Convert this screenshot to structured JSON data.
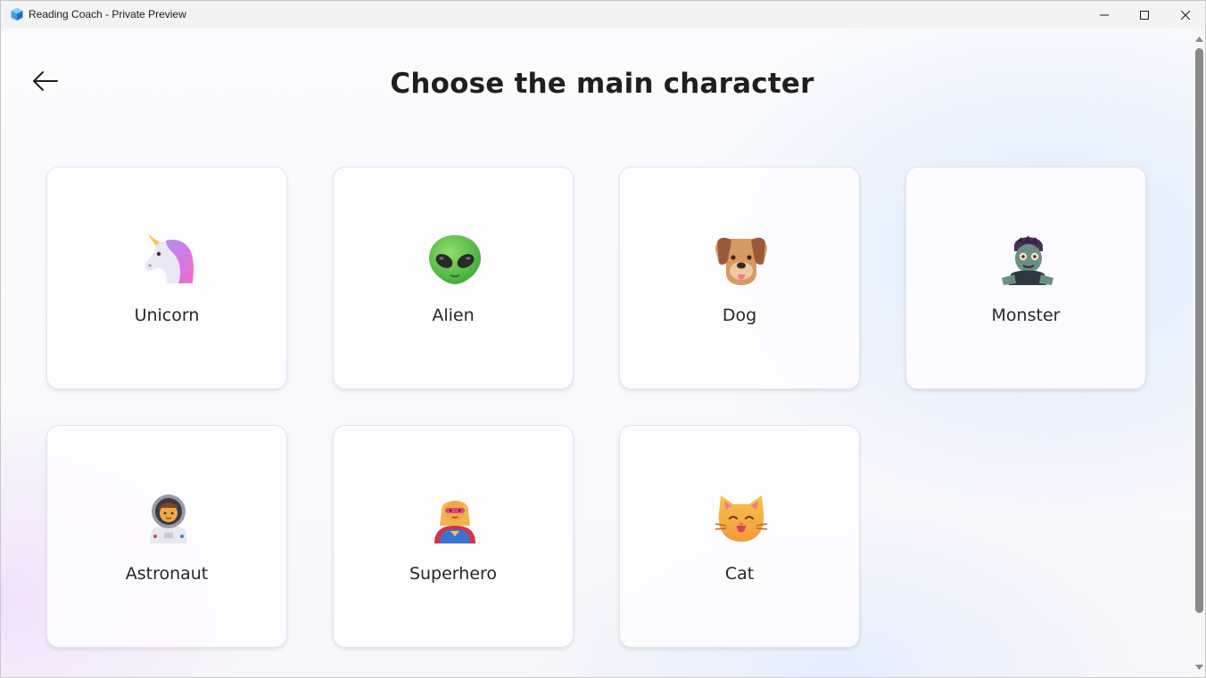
{
  "window": {
    "title": "Reading Coach - Private Preview",
    "app_icon": "reading-coach-app-icon",
    "controls": [
      "minimize-icon",
      "maximize-icon",
      "close-icon"
    ]
  },
  "header": {
    "back_icon": "arrow-left-icon",
    "title": "Choose the main character"
  },
  "characters": [
    {
      "label": "Unicorn",
      "icon": "unicorn-emoji"
    },
    {
      "label": "Alien",
      "icon": "alien-emoji"
    },
    {
      "label": "Dog",
      "icon": "dog-face-emoji"
    },
    {
      "label": "Monster",
      "icon": "zombie-emoji"
    },
    {
      "label": "Astronaut",
      "icon": "astronaut-emoji"
    },
    {
      "label": "Superhero",
      "icon": "superhero-emoji"
    },
    {
      "label": "Cat",
      "icon": "cat-face-emoji"
    }
  ],
  "colors": {
    "title_text": "#1f1f1f",
    "card_background": "#fdfcff",
    "scroll_thumb": "#8a8a8a"
  }
}
